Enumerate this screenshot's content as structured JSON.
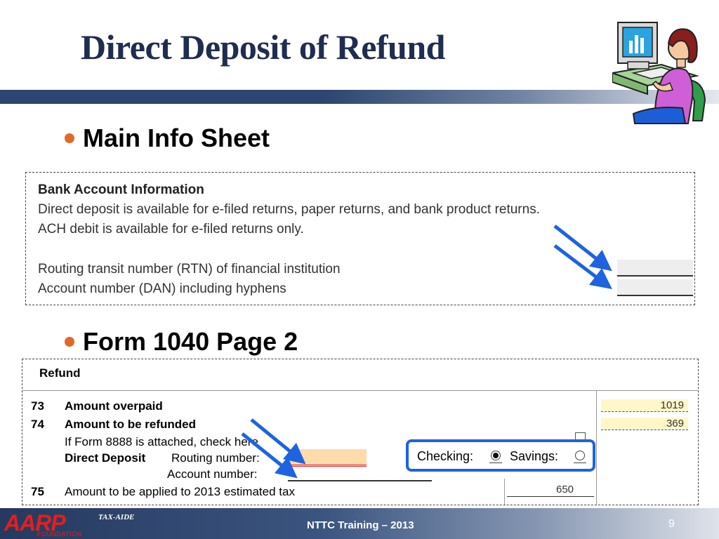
{
  "slide": {
    "title": "Direct Deposit of Refund",
    "bullets": [
      "Main Info Sheet",
      "Form 1040 Page 2"
    ]
  },
  "bank_info": {
    "heading": "Bank Account Information",
    "line1": "Direct deposit is available for e-filed returns, paper returns, and bank product returns.",
    "line2": "ACH debit is available for e-filed returns only.",
    "rtn_label": "Routing transit number (RTN) of financial institution",
    "dan_label": "Account number (DAN) including hyphens"
  },
  "refund_form": {
    "heading": "Refund",
    "line73": {
      "num": "73",
      "label": "Amount overpaid",
      "value": "1019"
    },
    "line74": {
      "num": "74",
      "label": "Amount to be refunded",
      "value": "369"
    },
    "form8888": "If Form 8888 is attached, check here",
    "direct_deposit": "Direct Deposit",
    "routing_label": "Routing number:",
    "account_label": "Account number:",
    "checking_label": "Checking:",
    "savings_label": "Savings:",
    "line75": {
      "num": "75",
      "label": "Amount to be applied to 2013 estimated tax",
      "value": "650"
    }
  },
  "footer": {
    "logo": "AARP",
    "foundation": "FOUNDATION",
    "tax_aide": "TAX-AIDE",
    "training": "NTTC Training – 2013",
    "page_number": "9"
  },
  "colors": {
    "title": "#1f2d4f",
    "bullet_dot": "#e06a25",
    "arrow": "#1e63e0",
    "aarp_red": "#e02020",
    "highlight_yellow": "#fff7c8",
    "highlight_orange": "#fddbaa"
  },
  "icons": {
    "clipart": "person-at-computer-clipart",
    "arrows": "blue-pointer-arrow"
  }
}
